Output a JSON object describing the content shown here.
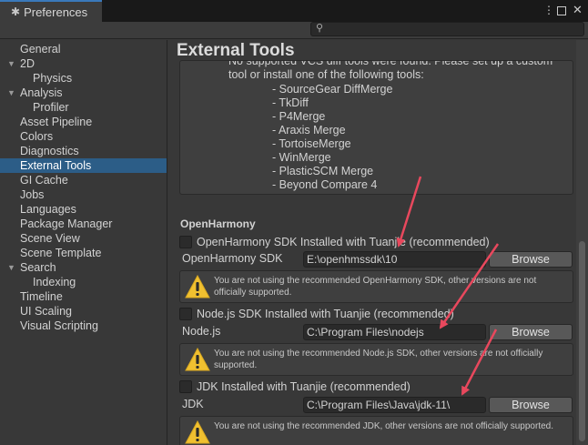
{
  "window": {
    "title": "Preferences",
    "gear_icon": "gear-icon",
    "menu_glyph": "⋮",
    "close_glyph": "✕"
  },
  "search": {
    "placeholder": "",
    "icon": "search-icon"
  },
  "sidebar": {
    "items": [
      {
        "label": "General",
        "indent": 0,
        "expandable": false,
        "selected": false
      },
      {
        "label": "2D",
        "indent": 0,
        "expandable": true,
        "selected": false
      },
      {
        "label": "Physics",
        "indent": 1,
        "expandable": false,
        "selected": false
      },
      {
        "label": "Analysis",
        "indent": 0,
        "expandable": true,
        "selected": false
      },
      {
        "label": "Profiler",
        "indent": 1,
        "expandable": false,
        "selected": false
      },
      {
        "label": "Asset Pipeline",
        "indent": 0,
        "expandable": false,
        "selected": false
      },
      {
        "label": "Colors",
        "indent": 0,
        "expandable": false,
        "selected": false
      },
      {
        "label": "Diagnostics",
        "indent": 0,
        "expandable": false,
        "selected": false
      },
      {
        "label": "External Tools",
        "indent": 0,
        "expandable": false,
        "selected": true
      },
      {
        "label": "GI Cache",
        "indent": 0,
        "expandable": false,
        "selected": false
      },
      {
        "label": "Jobs",
        "indent": 0,
        "expandable": false,
        "selected": false
      },
      {
        "label": "Languages",
        "indent": 0,
        "expandable": false,
        "selected": false
      },
      {
        "label": "Package Manager",
        "indent": 0,
        "expandable": false,
        "selected": false
      },
      {
        "label": "Scene View",
        "indent": 0,
        "expandable": false,
        "selected": false
      },
      {
        "label": "Scene Template",
        "indent": 0,
        "expandable": false,
        "selected": false
      },
      {
        "label": "Search",
        "indent": 0,
        "expandable": true,
        "selected": false
      },
      {
        "label": "Indexing",
        "indent": 1,
        "expandable": false,
        "selected": false
      },
      {
        "label": "Timeline",
        "indent": 0,
        "expandable": false,
        "selected": false
      },
      {
        "label": "UI Scaling",
        "indent": 0,
        "expandable": false,
        "selected": false
      },
      {
        "label": "Visual Scripting",
        "indent": 0,
        "expandable": false,
        "selected": false
      }
    ]
  },
  "main": {
    "title": "External Tools",
    "vcs_message": {
      "lines": [
        "No supported VCS diff tools were found. Please set up a custom",
        "tool or install one of the following tools:"
      ],
      "tools": [
        "- SourceGear DiffMerge",
        "- TkDiff",
        "- P4Merge",
        "- Araxis Merge",
        "- TortoiseMerge",
        "- WinMerge",
        "- PlasticSCM Merge",
        "- Beyond Compare 4"
      ]
    },
    "section_title": "OpenHarmony",
    "sdk_blocks": [
      {
        "toggle_label": "OpenHarmony SDK Installed with Tuanjie (recommended)",
        "checked": false,
        "field_label": "OpenHarmony SDK",
        "path": "E:\\openhmssdk\\10",
        "browse_label": "Browse",
        "warning": "You are not using the recommended OpenHarmony SDK, other versions are not officially supported."
      },
      {
        "toggle_label": "Node.js SDK Installed with Tuanjie (recommended)",
        "checked": false,
        "field_label": "Node.js",
        "path": "C:\\Program Files\\nodejs",
        "browse_label": "Browse",
        "warning": "You are not using the recommended Node.js SDK, other versions are not officially supported."
      },
      {
        "toggle_label": "JDK Installed with Tuanjie (recommended)",
        "checked": false,
        "field_label": "JDK",
        "path": "C:\\Program Files\\Java\\jdk-11\\",
        "browse_label": "Browse",
        "warning": "You are not using the recommended JDK, other versions are not officially supported."
      }
    ]
  },
  "colors": {
    "selection": "#2c5d87",
    "annotation_arrow": "#e8485d",
    "warning_icon": "#f0c030"
  }
}
